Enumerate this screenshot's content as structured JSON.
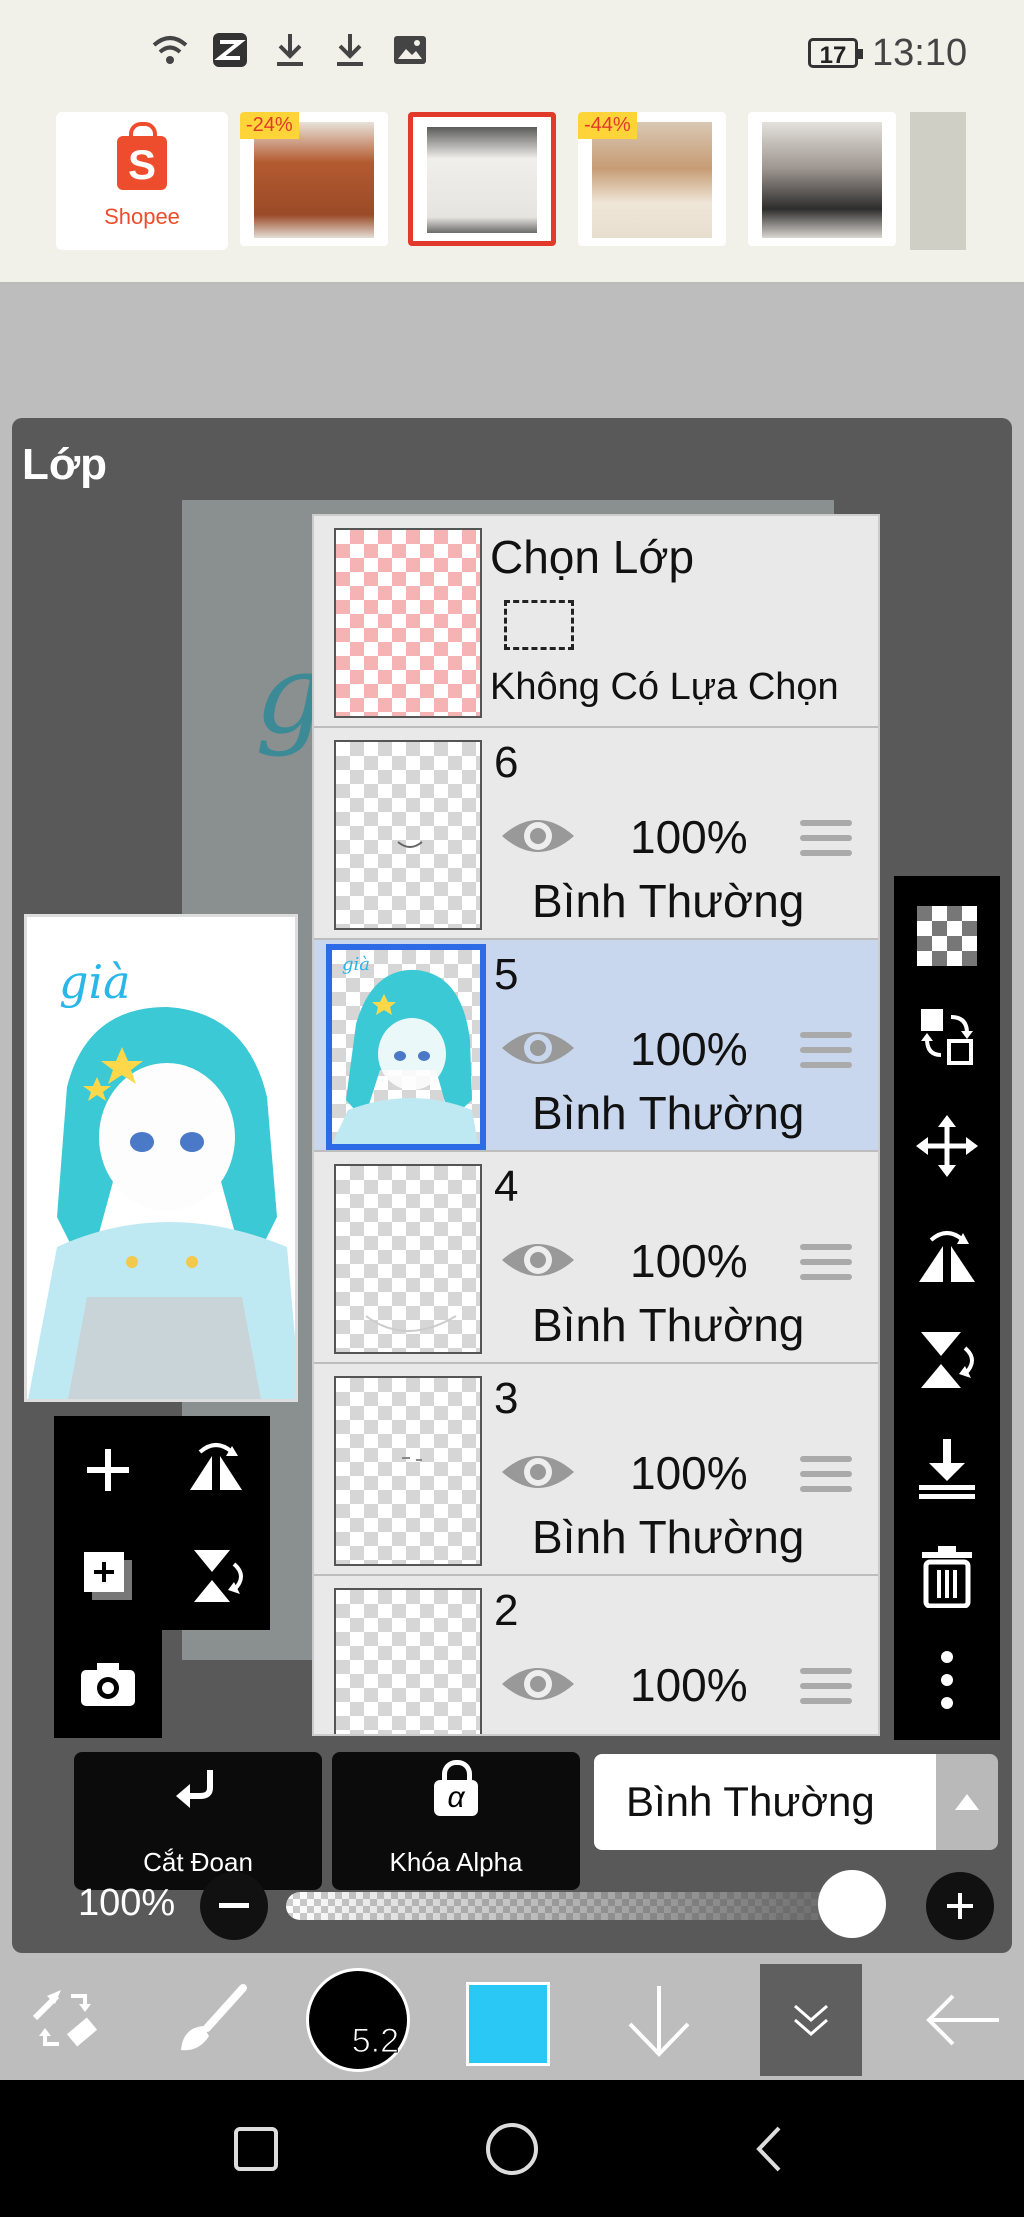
{
  "status_bar": {
    "icons": [
      "wifi-icon",
      "capcut-icon",
      "download-icon",
      "download-icon",
      "gallery-icon"
    ],
    "battery": "17",
    "time": "13:10"
  },
  "ad": {
    "brand": "Shopee",
    "brand_letter": "S",
    "items": [
      {
        "badge": "-24%"
      },
      {
        "badge": ""
      },
      {
        "badge": "-44%"
      },
      {
        "badge": ""
      }
    ]
  },
  "panel": {
    "title": "Lớp",
    "preview_caption": "già"
  },
  "selection_layer": {
    "title": "Chọn Lớp",
    "status": "Không Có Lựa Chọn"
  },
  "layers": [
    {
      "number": "6",
      "opacity": "100%",
      "blend": "Bình Thường",
      "visible": true
    },
    {
      "number": "5",
      "opacity": "100%",
      "blend": "Bình Thường",
      "visible": true,
      "active": true
    },
    {
      "number": "4",
      "opacity": "100%",
      "blend": "Bình Thường",
      "visible": true
    },
    {
      "number": "3",
      "opacity": "100%",
      "blend": "Bình Thường",
      "visible": true
    },
    {
      "number": "2",
      "opacity": "100%",
      "blend": "",
      "visible": true
    }
  ],
  "right_tools": [
    "transparent-bg-icon",
    "swap-layer-icon",
    "move-icon",
    "flip-horizontal-icon",
    "flip-vertical-icon",
    "merge-down-icon",
    "trash-icon",
    "more-vert-icon"
  ],
  "left_tools": [
    "add-layer-icon",
    "flip-horizontal-icon",
    "duplicate-layer-icon",
    "flip-vertical-icon",
    "camera-icon"
  ],
  "bottom_controls": {
    "clip_label": "Cắt Đoạn",
    "alpha_lock_label": "Khóa Alpha",
    "alpha_symbol": "α",
    "blend_mode": "Bình Thường",
    "opacity_label": "100%",
    "opacity_value": 1.0
  },
  "main_toolbar": {
    "brush_size": "5.2",
    "color": "#29c8f5"
  },
  "colors": {
    "active_layer_bg": "#c9d7ee",
    "active_layer_border": "#2d6be6",
    "shopee": "#ee4d2d"
  }
}
